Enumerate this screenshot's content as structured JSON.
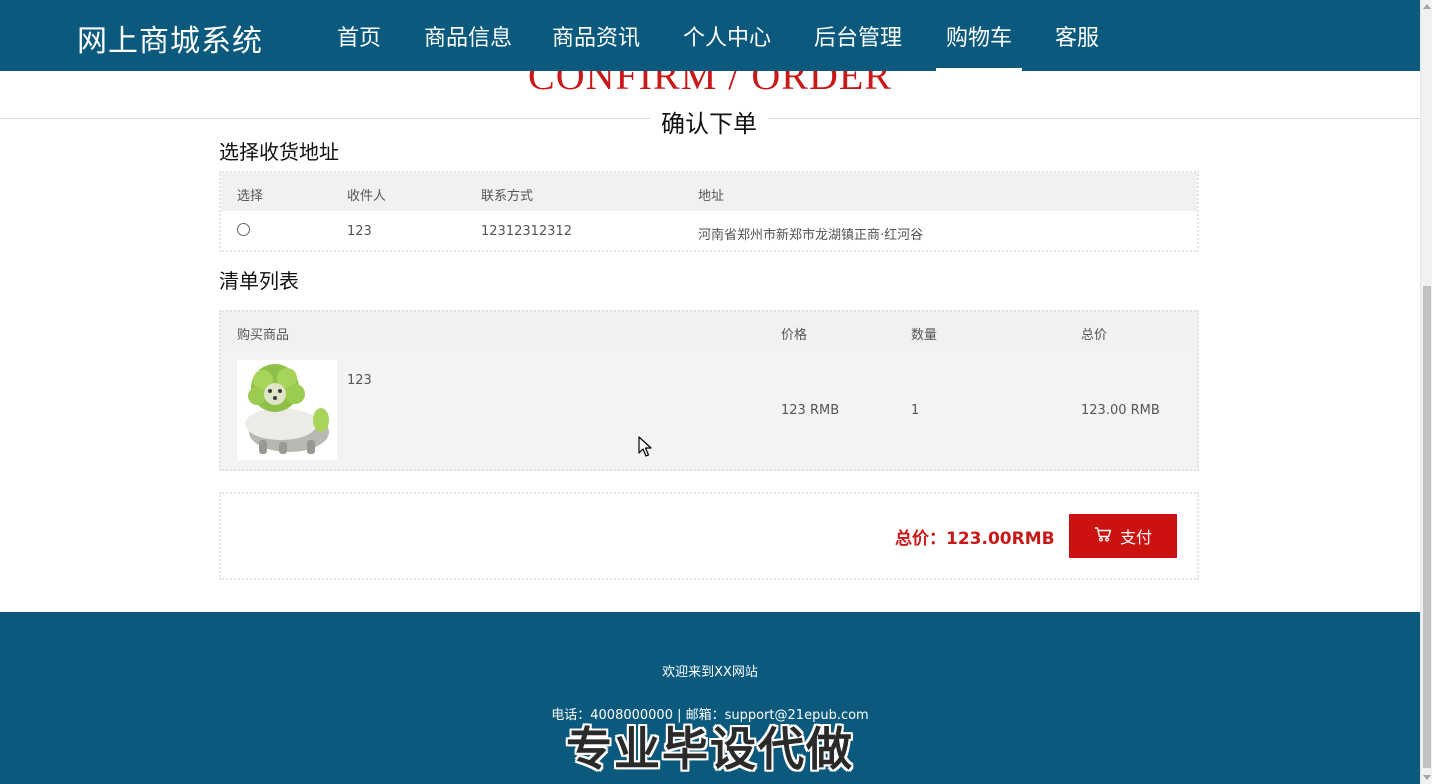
{
  "header": {
    "brand": "网上商城系统",
    "nav": [
      "首页",
      "商品信息",
      "商品资讯",
      "个人中心",
      "后台管理",
      "购物车",
      "客服"
    ],
    "active_index": 5
  },
  "page_title": {
    "en": "CONFIRM / ORDER",
    "zh": "确认下单"
  },
  "address_section": {
    "heading": "选择收货地址",
    "columns": [
      "选择",
      "收件人",
      "联系方式",
      "地址"
    ],
    "rows": [
      {
        "selected": false,
        "recipient": "123",
        "phone": "12312312312",
        "address": "河南省郑州市新郑市龙湖镇正商·红河谷"
      }
    ]
  },
  "order_list": {
    "heading": "清单列表",
    "columns": [
      "购买商品",
      "价格",
      "数量",
      "总价"
    ],
    "items": [
      {
        "name": "123",
        "price": "123 RMB",
        "quantity": "1",
        "subtotal": "123.00 RMB",
        "image": "cabbage-dog-illustration"
      }
    ]
  },
  "summary": {
    "total_label": "总价：123.00RMB",
    "pay_button": "支付",
    "pay_icon": "cart-icon"
  },
  "footer": {
    "welcome": "欢迎来到XX网站",
    "contact": "电话：4008000000 | 邮箱：support@21epub.com",
    "watermark": "专业毕设代做"
  },
  "colors": {
    "primary": "#0b5a7e",
    "accent": "#c81818",
    "button": "#cc1111"
  }
}
